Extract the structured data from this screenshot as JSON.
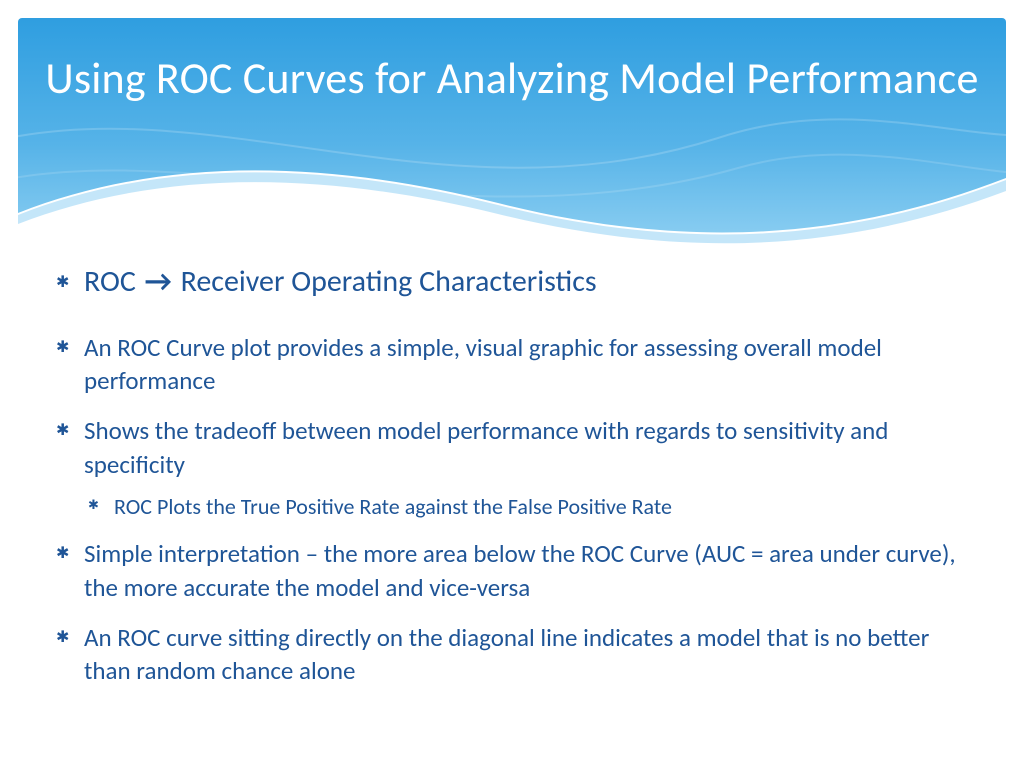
{
  "title": "Using ROC Curves for Analyzing Model Performance",
  "lead": {
    "pre": "ROC ",
    "arrow": "→",
    "post": " Receiver Operating Characteristics"
  },
  "bullets": [
    "An ROC Curve plot provides a simple, visual graphic for assessing overall model performance",
    "Shows the tradeoff between model performance with regards to sensitivity and specificity",
    "Simple interpretation – the more area below the ROC Curve (AUC = area under curve), the more accurate the model and vice-versa",
    "An ROC curve sitting directly on the diagonal line indicates a model that is no better than random chance alone"
  ],
  "subbullet": "ROC Plots the True Positive Rate against the False Positive Rate"
}
